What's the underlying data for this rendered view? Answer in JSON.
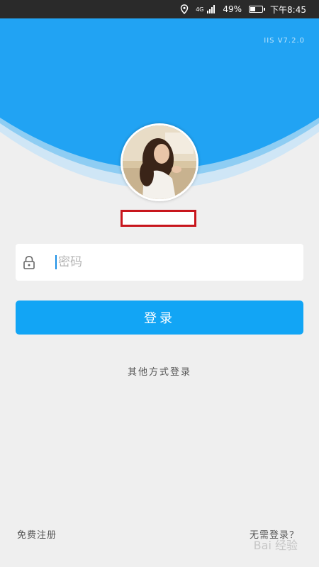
{
  "status_bar": {
    "network": "4G",
    "battery": "49%",
    "battery_level": 0.49,
    "time": "下午8:45",
    "icons": [
      "location-icon",
      "signal-icon",
      "battery-icon"
    ]
  },
  "app": {
    "version": "IIS V7.2.0"
  },
  "login": {
    "password_placeholder": "密码",
    "login_button": "登录",
    "other_methods": "其他方式登录",
    "register": "免费注册",
    "password_free": "无需登录？"
  },
  "watermark": "Bai 经验",
  "colors": {
    "header_blue": "#21a3f3",
    "button_blue": "#12a5f5",
    "background": "#efefef",
    "highlight_red": "#c8161d"
  }
}
